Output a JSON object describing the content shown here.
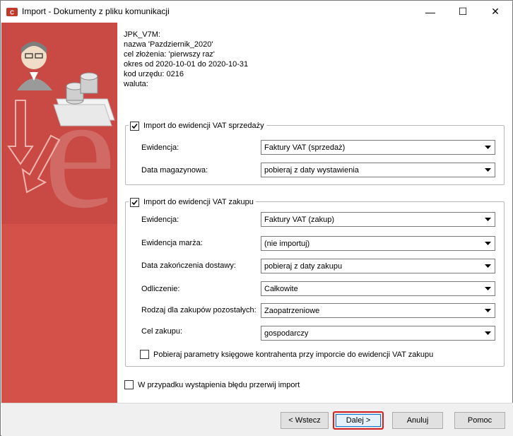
{
  "window": {
    "title": "Import - Dokumenty z pliku komunikacji",
    "minimize_glyph": "—",
    "maximize_glyph": "☐",
    "close_glyph": "✕"
  },
  "info": {
    "line1": "JPK_V7M:",
    "line2": "nazwa 'Pazdziernik_2020'",
    "line3": "cel złożenia: 'pierwszy raz'",
    "line4": "okres od 2020-10-01 do 2020-10-31",
    "line5": "kod urzędu: 0216",
    "line6": "waluta:"
  },
  "sales": {
    "legend": "Import do ewidencji VAT sprzedaży",
    "checked": true,
    "rows": [
      {
        "label": "Ewidencja:",
        "value": "Faktury VAT (sprzedaż)"
      },
      {
        "label": "Data magazynowa:",
        "value": "pobieraj z daty wystawienia"
      }
    ]
  },
  "purchase": {
    "legend": "Import do ewidencji VAT zakupu",
    "checked": true,
    "rows": [
      {
        "label": "Ewidencja:",
        "value": "Faktury VAT (zakup)"
      },
      {
        "label": "Ewidencja marża:",
        "value": "(nie importuj)"
      },
      {
        "label": "Data zakończenia dostawy:",
        "value": "pobieraj z daty zakupu"
      },
      {
        "label": "Odliczenie:",
        "value": "Całkowite"
      },
      {
        "label": "Rodzaj dla zakupów pozostałych:",
        "value": "Zaopatrzeniowe"
      },
      {
        "label": "Cel zakupu:",
        "value": "gospodarczy"
      }
    ],
    "params_checkbox": {
      "label": "Pobieraj parametry księgowe kontrahenta przy imporcie do ewidencji VAT zakupu",
      "checked": false
    }
  },
  "stop_on_error": {
    "label": "W przypadku wystąpienia błędu przerwij import",
    "checked": false
  },
  "buttons": {
    "back": "< Wstecz",
    "next": "Dalej >",
    "cancel": "Anuluj",
    "help": "Pomoc"
  },
  "colors": {
    "side_panel": "#d4514a",
    "highlight": "#d62020"
  }
}
